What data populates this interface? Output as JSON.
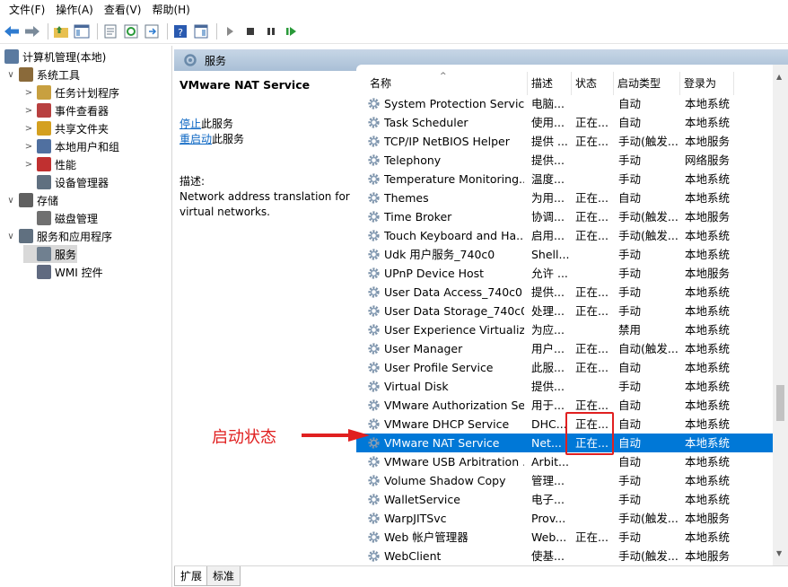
{
  "menu": [
    "文件(F)",
    "操作(A)",
    "查看(V)",
    "帮助(H)"
  ],
  "tree": {
    "root": "计算机管理(本地)",
    "nodes": [
      {
        "label": "系统工具",
        "expander": "∨",
        "level": 1,
        "icon": "tools-icon",
        "color": "#8a6a3a"
      },
      {
        "label": "任务计划程序",
        "expander": ">",
        "level": 2,
        "icon": "clock-icon",
        "color": "#c8a040"
      },
      {
        "label": "事件查看器",
        "expander": ">",
        "level": 2,
        "icon": "event-viewer-icon",
        "color": "#b84040"
      },
      {
        "label": "共享文件夹",
        "expander": ">",
        "level": 2,
        "icon": "shared-folder-icon",
        "color": "#d4a020"
      },
      {
        "label": "本地用户和组",
        "expander": ">",
        "level": 2,
        "icon": "users-icon",
        "color": "#5070a0"
      },
      {
        "label": "性能",
        "expander": ">",
        "level": 2,
        "icon": "performance-icon",
        "color": "#c03030"
      },
      {
        "label": "设备管理器",
        "expander": "",
        "level": 2,
        "icon": "device-manager-icon",
        "color": "#607080"
      },
      {
        "label": "存储",
        "expander": "∨",
        "level": 1,
        "icon": "storage-icon",
        "color": "#606060"
      },
      {
        "label": "磁盘管理",
        "expander": "",
        "level": 2,
        "icon": "disk-icon",
        "color": "#707070"
      },
      {
        "label": "服务和应用程序",
        "expander": "∨",
        "level": 1,
        "icon": "services-apps-icon",
        "color": "#607080"
      },
      {
        "label": "服务",
        "expander": "",
        "level": 2,
        "icon": "services-icon",
        "color": "#708090",
        "selected": true
      },
      {
        "label": "WMI 控件",
        "expander": "",
        "level": 2,
        "icon": "wmi-icon",
        "color": "#606a80"
      }
    ]
  },
  "header": {
    "title": "服务"
  },
  "description": {
    "service_name": "VMware NAT Service",
    "stop_link": "停止",
    "stop_suffix": "此服务",
    "restart_link": "重启动",
    "restart_suffix": "此服务",
    "desc_label": "描述:",
    "desc_text": "Network address translation for virtual networks."
  },
  "columns": {
    "name": "名称",
    "desc": "描述",
    "status": "状态",
    "startup": "启动类型",
    "logon": "登录为"
  },
  "services": [
    {
      "name": "System Protection Service",
      "desc": "电脑...",
      "status": "",
      "startup": "自动",
      "logon": "本地系统"
    },
    {
      "name": "Task Scheduler",
      "desc": "使用...",
      "status": "正在...",
      "startup": "自动",
      "logon": "本地系统"
    },
    {
      "name": "TCP/IP NetBIOS Helper",
      "desc": "提供 ...",
      "status": "正在...",
      "startup": "手动(触发...",
      "logon": "本地服务"
    },
    {
      "name": "Telephony",
      "desc": "提供...",
      "status": "",
      "startup": "手动",
      "logon": "网络服务"
    },
    {
      "name": "Temperature Monitoring...",
      "desc": "温度...",
      "status": "",
      "startup": "手动",
      "logon": "本地系统"
    },
    {
      "name": "Themes",
      "desc": "为用...",
      "status": "正在...",
      "startup": "自动",
      "logon": "本地系统"
    },
    {
      "name": "Time Broker",
      "desc": "协调...",
      "status": "正在...",
      "startup": "手动(触发...",
      "logon": "本地服务"
    },
    {
      "name": "Touch Keyboard and Ha...",
      "desc": "启用...",
      "status": "正在...",
      "startup": "手动(触发...",
      "logon": "本地系统"
    },
    {
      "name": "Udk 用户服务_740c0",
      "desc": "Shell...",
      "status": "",
      "startup": "手动",
      "logon": "本地系统"
    },
    {
      "name": "UPnP Device Host",
      "desc": "允许 ...",
      "status": "",
      "startup": "手动",
      "logon": "本地服务"
    },
    {
      "name": "User Data Access_740c0",
      "desc": "提供...",
      "status": "正在...",
      "startup": "手动",
      "logon": "本地系统"
    },
    {
      "name": "User Data Storage_740c0",
      "desc": "处理...",
      "status": "正在...",
      "startup": "手动",
      "logon": "本地系统"
    },
    {
      "name": "User Experience Virtualiz...",
      "desc": "为应...",
      "status": "",
      "startup": "禁用",
      "logon": "本地系统"
    },
    {
      "name": "User Manager",
      "desc": "用户...",
      "status": "正在...",
      "startup": "自动(触发...",
      "logon": "本地系统"
    },
    {
      "name": "User Profile Service",
      "desc": "此服...",
      "status": "正在...",
      "startup": "自动",
      "logon": "本地系统"
    },
    {
      "name": "Virtual Disk",
      "desc": "提供...",
      "status": "",
      "startup": "手动",
      "logon": "本地系统"
    },
    {
      "name": "VMware Authorization Se...",
      "desc": "用于...",
      "status": "正在...",
      "startup": "自动",
      "logon": "本地系统"
    },
    {
      "name": "VMware DHCP Service",
      "desc": "DHC...",
      "status": "正在...",
      "startup": "自动",
      "logon": "本地系统"
    },
    {
      "name": "VMware NAT Service",
      "desc": "Net...",
      "status": "正在...",
      "startup": "自动",
      "logon": "本地系统",
      "selected": true
    },
    {
      "name": "VMware USB Arbitration ...",
      "desc": "Arbit...",
      "status": "",
      "startup": "自动",
      "logon": "本地系统"
    },
    {
      "name": "Volume Shadow Copy",
      "desc": "管理...",
      "status": "",
      "startup": "手动",
      "logon": "本地系统"
    },
    {
      "name": "WalletService",
      "desc": "电子...",
      "status": "",
      "startup": "手动",
      "logon": "本地系统"
    },
    {
      "name": "WarpJITSvc",
      "desc": "Prov...",
      "status": "",
      "startup": "手动(触发...",
      "logon": "本地服务"
    },
    {
      "name": "Web 帐户管理器",
      "desc": "Web...",
      "status": "正在...",
      "startup": "手动",
      "logon": "本地系统"
    },
    {
      "name": "WebClient",
      "desc": "使基...",
      "status": "",
      "startup": "手动(触发...",
      "logon": "本地服务"
    }
  ],
  "tabs": [
    "扩展",
    "标准"
  ],
  "annotation": {
    "text": "启动状态",
    "color": "#e02020"
  },
  "colors": {
    "selection": "#0078d7",
    "header_bar": "#b8cadf",
    "link": "#0b66c3"
  }
}
